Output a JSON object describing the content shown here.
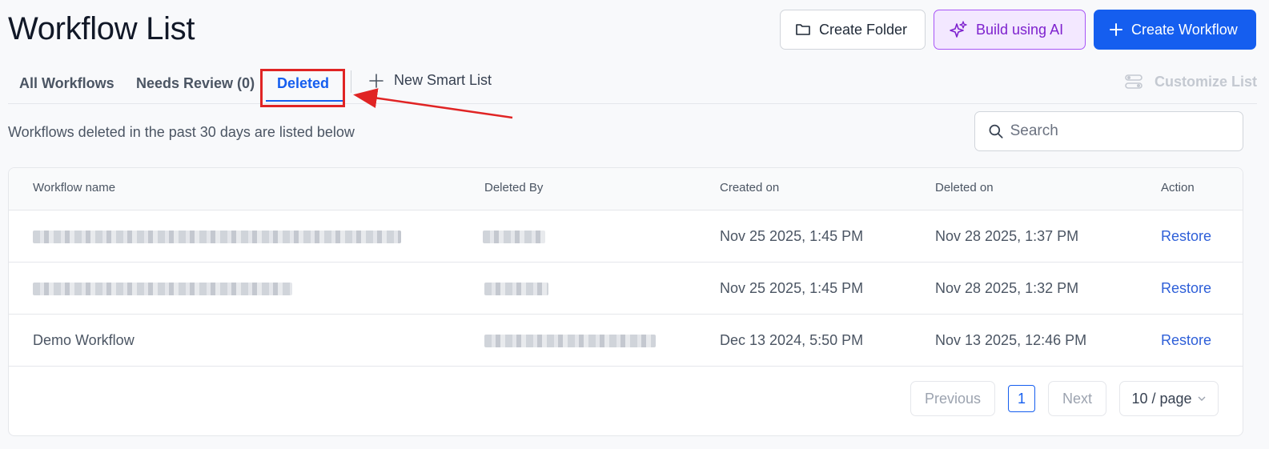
{
  "header": {
    "title": "Workflow List",
    "create_folder_label": "Create Folder",
    "build_ai_label": "Build using AI",
    "create_workflow_label": "Create Workflow"
  },
  "tabs": [
    {
      "label": "All Workflows",
      "active": false
    },
    {
      "label": "Needs Review (0)",
      "active": false
    },
    {
      "label": "Deleted",
      "active": true
    }
  ],
  "new_smart_list_label": "New Smart List",
  "customize_list_label": "Customize List",
  "subtitle": "Workflows deleted in the past 30 days are listed below",
  "search": {
    "placeholder": "Search",
    "value": ""
  },
  "table": {
    "columns": [
      "Workflow name",
      "Deleted By",
      "Created on",
      "Deleted on",
      "Action"
    ],
    "rows": [
      {
        "name": "",
        "name_redacted": true,
        "deleted_by": "",
        "deleted_by_redacted": true,
        "created_on": "Nov 25 2025, 1:45 PM",
        "deleted_on": "Nov 28 2025, 1:37 PM",
        "action": "Restore"
      },
      {
        "name": "",
        "name_redacted": true,
        "deleted_by": "",
        "deleted_by_redacted": true,
        "created_on": "Nov 25 2025, 1:45 PM",
        "deleted_on": "Nov 28 2025, 1:32 PM",
        "action": "Restore"
      },
      {
        "name": "Demo Workflow",
        "name_redacted": false,
        "deleted_by": "",
        "deleted_by_redacted": true,
        "created_on": "Dec 13 2024, 5:50 PM",
        "deleted_on": "Nov 13 2025, 12:46 PM",
        "action": "Restore"
      }
    ]
  },
  "pagination": {
    "previous_label": "Previous",
    "current_page": "1",
    "next_label": "Next",
    "page_size_label": "10 / page"
  },
  "colors": {
    "primary": "#155eef",
    "ai_accent": "#7e22ce",
    "annotation_red": "#e02424"
  }
}
